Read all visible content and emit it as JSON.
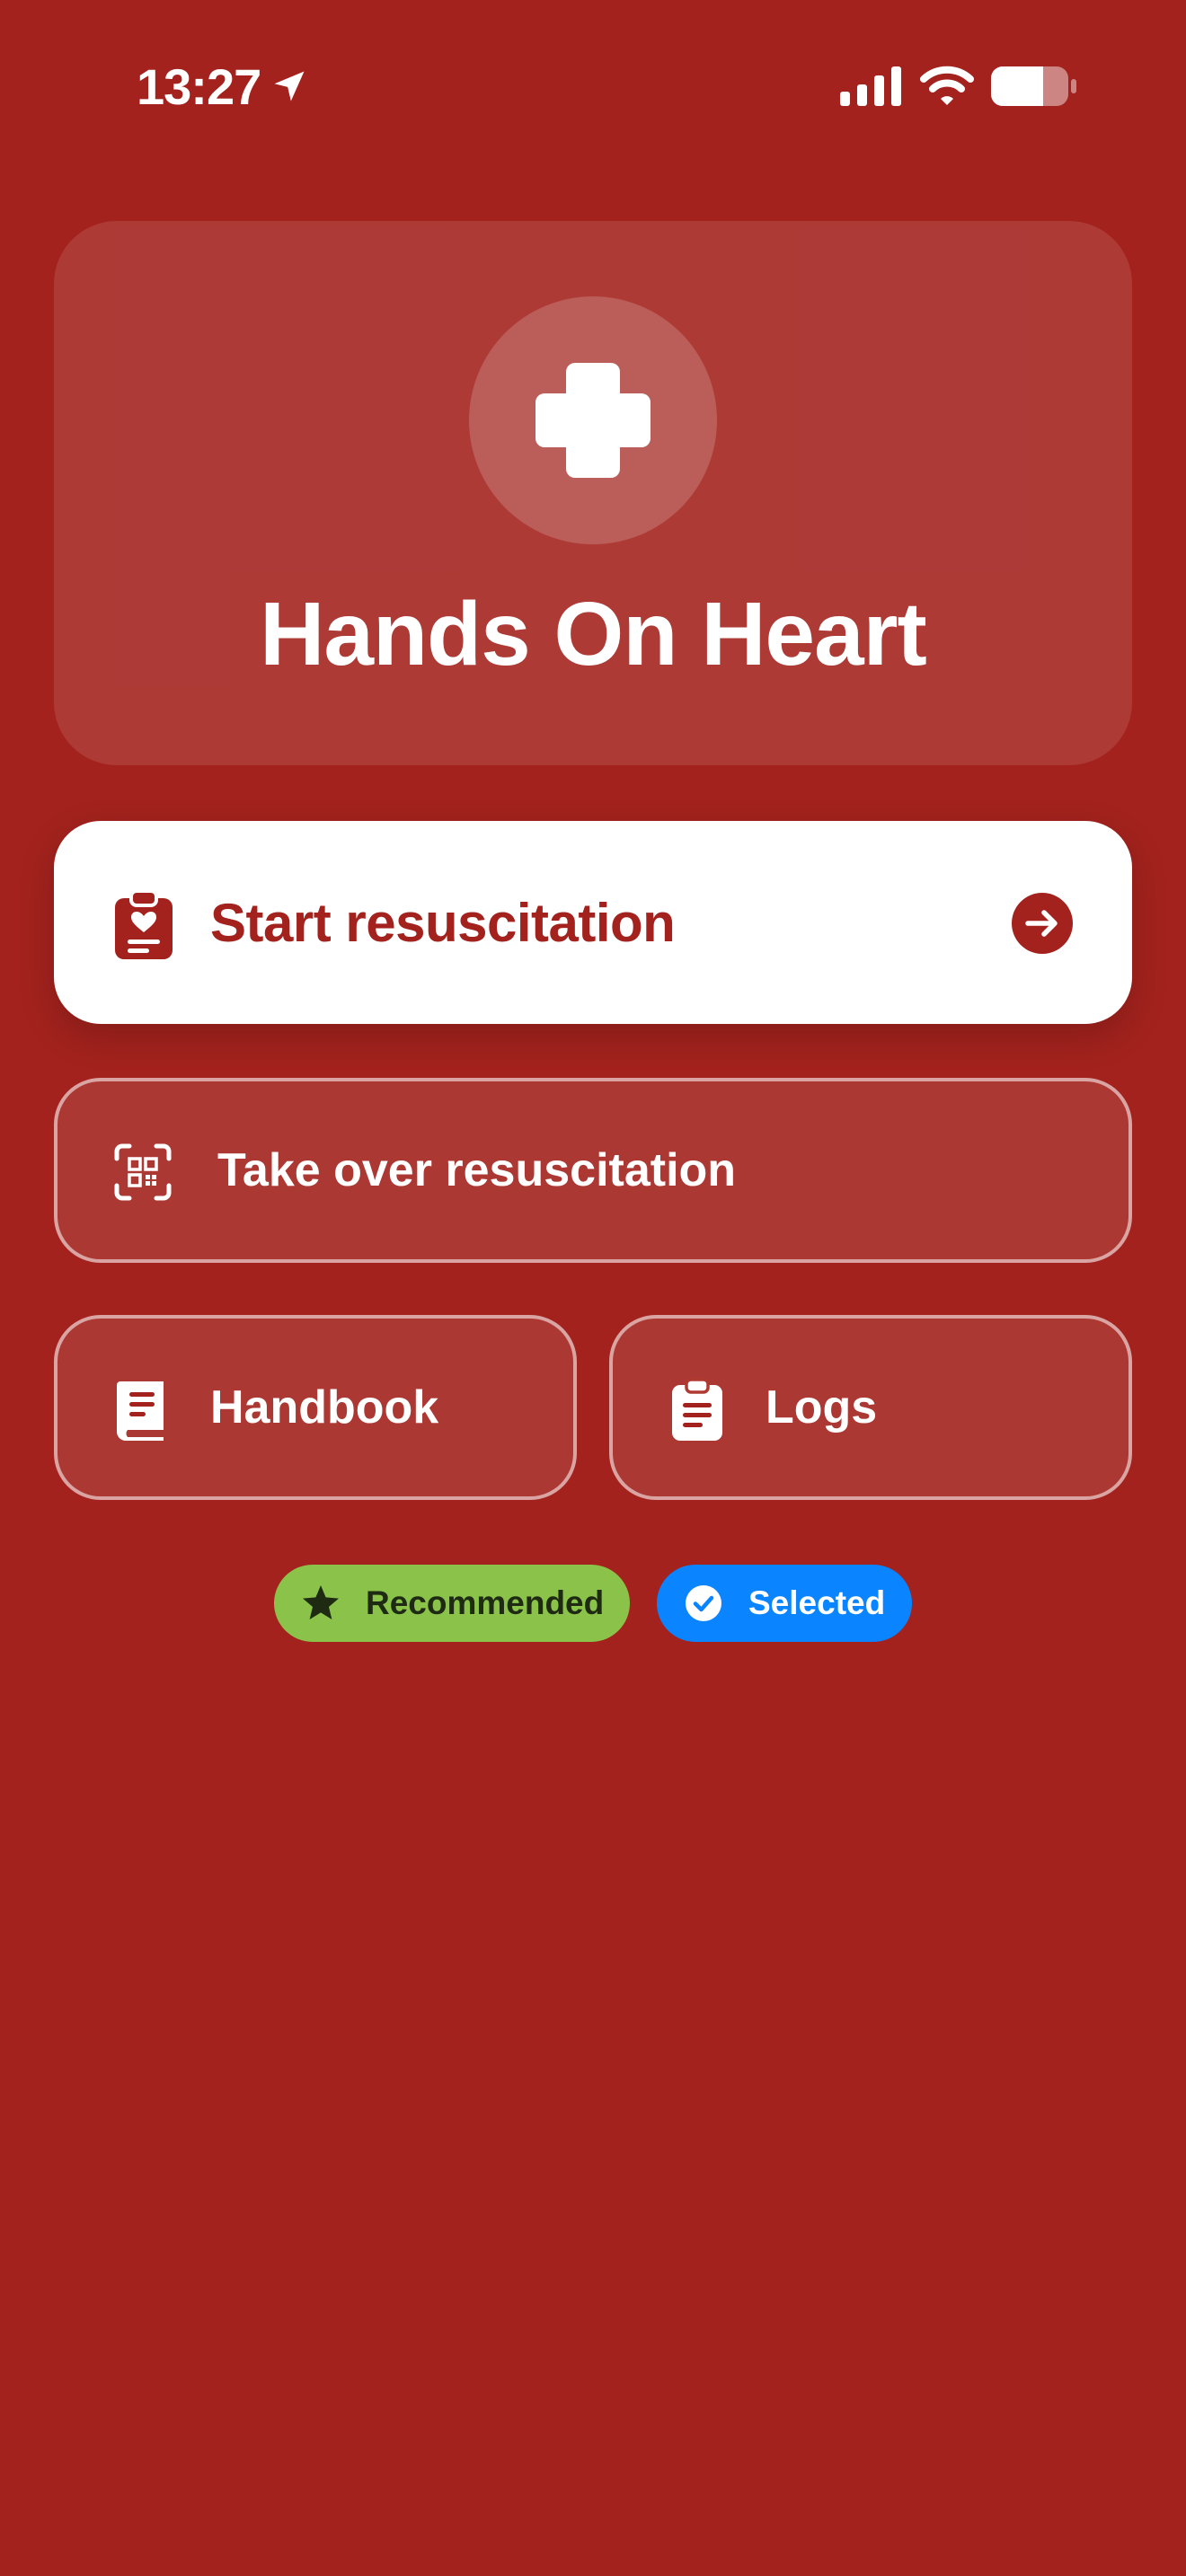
{
  "status_bar": {
    "time": "13:27",
    "icons": [
      "location-arrow-icon",
      "cellular-signal-icon",
      "wifi-icon",
      "battery-icon"
    ]
  },
  "hero": {
    "icon": "medical-cross-icon",
    "title": "Hands On Heart"
  },
  "actions": {
    "start": {
      "label": "Start resuscitation",
      "icon": "clipboard-heart-icon",
      "trailing_icon": "arrow-right-circle-icon"
    },
    "take_over": {
      "label": "Take over resuscitation",
      "icon": "qr-scan-icon"
    },
    "handbook": {
      "label": "Handbook",
      "icon": "book-icon"
    },
    "logs": {
      "label": "Logs",
      "icon": "clipboard-list-icon"
    }
  },
  "badges": {
    "recommended": {
      "label": "Recommended",
      "icon": "star-icon",
      "color": "#8BC34A"
    },
    "selected": {
      "label": "Selected",
      "icon": "checkmark-circle-icon",
      "color": "#0A84FF"
    }
  },
  "colors": {
    "background": "#A3221D",
    "primary_text": "#A3221D",
    "surface": "#FFFFFF"
  }
}
